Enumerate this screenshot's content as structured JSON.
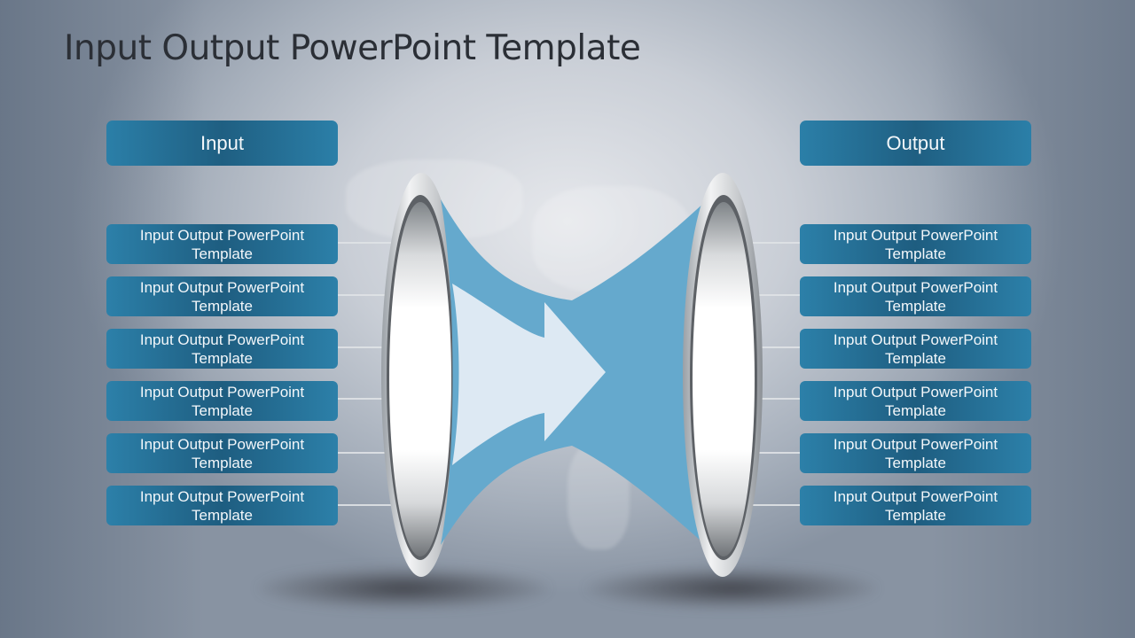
{
  "slide": {
    "title": "Input Output PowerPoint Template",
    "colors": {
      "header_blue": "#236d94",
      "flow_blue": "#65a9cd",
      "arrow_light": "#dde9f3",
      "title_text": "#2b2f36"
    }
  },
  "input": {
    "header": "Input",
    "items": [
      "Input Output  PowerPoint\nTemplate",
      "Input Output  PowerPoint\nTemplate",
      "Input Output  PowerPoint\nTemplate",
      "Input Output  PowerPoint\nTemplate",
      "Input Output  PowerPoint\nTemplate",
      "Input Output  PowerPoint\nTemplate"
    ]
  },
  "output": {
    "header": "Output",
    "items": [
      "Input Output  PowerPoint\nTemplate",
      "Input Output  PowerPoint\nTemplate",
      "Input Output  PowerPoint\nTemplate",
      "Input Output  PowerPoint\nTemplate",
      "Input Output  PowerPoint\nTemplate",
      "Input Output  PowerPoint\nTemplate"
    ]
  },
  "diagram": {
    "flow_direction": "left-to-right",
    "center_icon": "arrow-right-icon",
    "left_portal_icon": "ring-portal-icon",
    "right_portal_icon": "ring-portal-icon"
  }
}
